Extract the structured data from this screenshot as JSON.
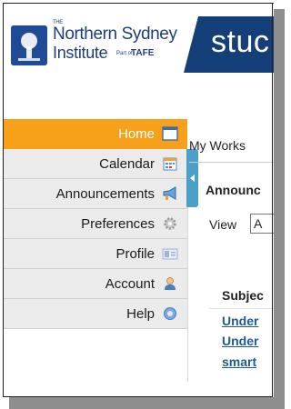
{
  "header": {
    "logo": {
      "the": "THE",
      "line1": "Northern Sydney",
      "line2": "Institute",
      "part_of": "Part of",
      "tafe": "TAFE"
    },
    "banner_text": "stuc",
    "banner_color": "#143f78"
  },
  "sidebar": {
    "items": [
      {
        "label": "Home",
        "icon": "window-icon",
        "active": true
      },
      {
        "label": "Calendar",
        "icon": "calendar-icon"
      },
      {
        "label": "Announcements",
        "icon": "megaphone-icon"
      },
      {
        "label": "Preferences",
        "icon": "gear-icon"
      },
      {
        "label": "Profile",
        "icon": "id-card-icon"
      },
      {
        "label": "Account",
        "icon": "user-icon"
      },
      {
        "label": "Help",
        "icon": "help-icon"
      }
    ],
    "active_color": "#f7a11a"
  },
  "content": {
    "tab_title": "My Works",
    "announcements_title": "Announc",
    "view_label": "View",
    "view_value": "A",
    "subject_header": "Subjec",
    "rows": [
      "Under",
      "Under",
      "smart"
    ],
    "link_color": "#1f5a96"
  }
}
